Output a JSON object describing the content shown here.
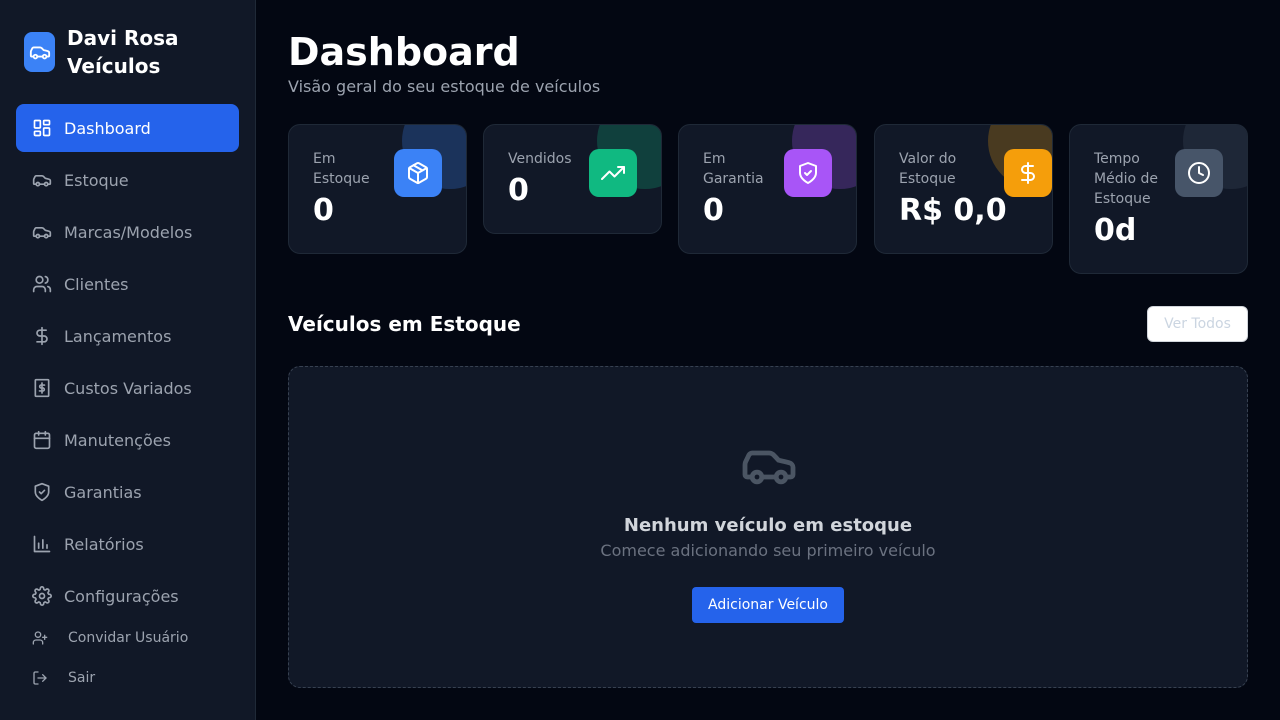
{
  "brand": {
    "name": "Davi Rosa Veículos",
    "logo_icon": "car-icon",
    "logo_color": "#3b82f6"
  },
  "sidebar": {
    "items": [
      {
        "label": "Dashboard",
        "icon": "dashboard-grid-icon",
        "active": true
      },
      {
        "label": "Estoque",
        "icon": "car-icon"
      },
      {
        "label": "Marcas/Modelos",
        "icon": "car-icon"
      },
      {
        "label": "Clientes",
        "icon": "users-icon"
      },
      {
        "label": "Lançamentos",
        "icon": "dollar-icon"
      },
      {
        "label": "Custos Variados",
        "icon": "receipt-icon"
      },
      {
        "label": "Manutenções",
        "icon": "calendar-icon"
      },
      {
        "label": "Garantias",
        "icon": "shield-check-icon"
      },
      {
        "label": "Relatórios",
        "icon": "bar-chart-icon"
      },
      {
        "label": "Configurações",
        "icon": "gear-icon"
      }
    ],
    "footer": [
      {
        "label": "Convidar Usuário",
        "icon": "user-plus-icon"
      },
      {
        "label": "Sair",
        "icon": "logout-icon"
      }
    ],
    "active_color": "#2563eb"
  },
  "header": {
    "title": "Dashboard",
    "subtitle": "Visão geral do seu estoque de veículos"
  },
  "stats": [
    {
      "label": "Em Estoque",
      "value": "0",
      "icon": "package-icon",
      "color": "#3b82f6"
    },
    {
      "label": "Vendidos",
      "value": "0",
      "icon": "trending-up-icon",
      "color": "#10b981"
    },
    {
      "label": "Em Garantia",
      "value": "0",
      "icon": "shield-check-icon",
      "color": "#a855f7"
    },
    {
      "label": "Valor do Estoque",
      "value": "R$ 0,0",
      "icon": "dollar-icon",
      "color": "#f59e0b"
    },
    {
      "label": "Tempo Médio de Estoque",
      "value": "0d",
      "icon": "clock-icon",
      "color": "#475569"
    }
  ],
  "inventory": {
    "title": "Veículos em Estoque",
    "view_all_label": "Ver Todos",
    "empty_icon": "car-icon",
    "empty_title": "Nenhum veículo em estoque",
    "empty_subtitle": "Comece adicionando seu primeiro veículo",
    "add_button_label": "Adicionar Veículo"
  }
}
